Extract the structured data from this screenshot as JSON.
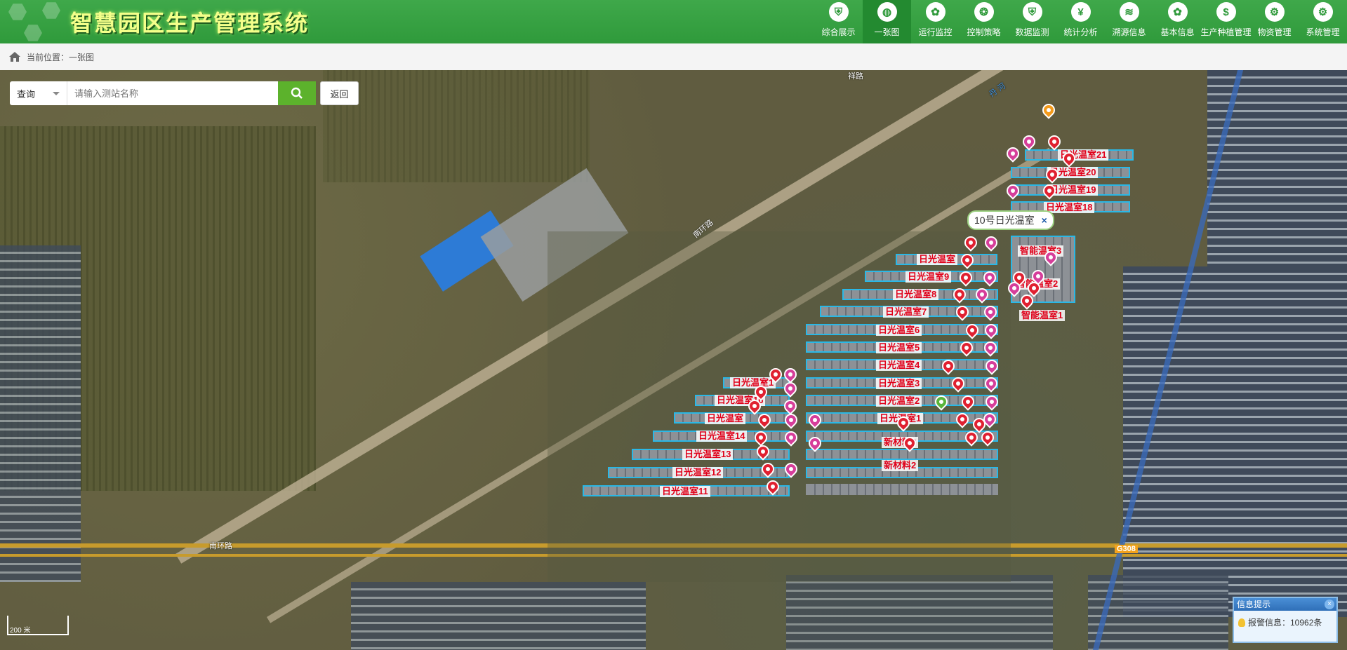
{
  "header": {
    "app_title": "智慧园区生产管理系统",
    "nav": [
      {
        "label": "综合展示",
        "icon": "shield-icon",
        "glyph": "⛨",
        "active": false
      },
      {
        "label": "一张图",
        "icon": "globe-icon",
        "glyph": "◍",
        "active": true
      },
      {
        "label": "运行监控",
        "icon": "monitor-icon",
        "glyph": "✿",
        "active": false
      },
      {
        "label": "控制策略",
        "icon": "control-icon",
        "glyph": "❂",
        "active": false
      },
      {
        "label": "数据监测",
        "icon": "data-icon",
        "glyph": "⛨",
        "active": false
      },
      {
        "label": "统计分析",
        "icon": "stats-icon",
        "glyph": "¥",
        "active": false
      },
      {
        "label": "溯源信息",
        "icon": "trace-icon",
        "glyph": "≋",
        "active": false
      },
      {
        "label": "基本信息",
        "icon": "info-icon",
        "glyph": "✿",
        "active": false
      },
      {
        "label": "生产种植管理",
        "icon": "dollar-icon",
        "glyph": "$",
        "active": false
      },
      {
        "label": "物资管理",
        "icon": "gear-icon",
        "glyph": "⚙",
        "active": false
      },
      {
        "label": "系统管理",
        "icon": "settings-icon",
        "glyph": "⚙",
        "active": false
      }
    ]
  },
  "breadcrumb": {
    "text": "当前位置：一张图"
  },
  "search": {
    "select_value": "查询",
    "placeholder": "请输入测站名称",
    "back_label": "返回"
  },
  "popup": {
    "text": "10号日光温室",
    "close": "×"
  },
  "map": {
    "road_labels": [
      "南环路",
      "南环路",
      "丹 河",
      "G308",
      "祥路"
    ],
    "greenhouses": [
      "日光温室21",
      "日光温室20",
      "日光温室19",
      "日光温室18",
      "智能温室3",
      "智能温室2",
      "智能温室1",
      "日光温室",
      "日光温室9",
      "日光温室8",
      "日光温室7",
      "日光温室6",
      "日光温室5",
      "日光温室4",
      "日光温室3",
      "日光温室2",
      "日光温室1",
      "新材料3",
      "新材料2",
      "日光温室1",
      "日光温室16",
      "日光温室",
      "日光温室14",
      "日光温室13",
      "日光温室12",
      "日光温室11"
    ]
  },
  "info_panel": {
    "title": "信息提示",
    "close": "×",
    "message": "报警信息：10962条"
  },
  "scale": {
    "text": "200 米"
  },
  "colors": {
    "header": "#2f9a3b",
    "accent": "#5cb22c",
    "greenhouse_border": "#2ab8e6",
    "label_red": "#e0001a"
  }
}
